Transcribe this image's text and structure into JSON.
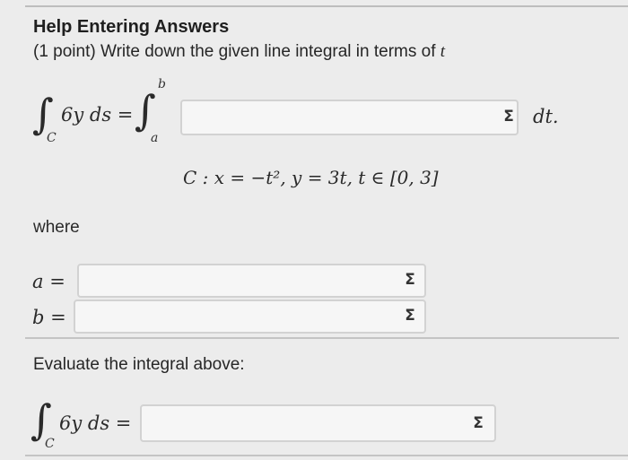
{
  "header": {
    "title": "Help Entering Answers",
    "prompt_points": "(1 point) Write down the given line integral in terms of",
    "prompt_var": "t"
  },
  "integral_1": {
    "integrand": "6y ds =",
    "lower_sub": "C",
    "upper_limit": "b",
    "lower_limit": "a",
    "trailing": "dt."
  },
  "curve": {
    "text": "C : x = −t², y = 3t, t ∈ [0, 3]"
  },
  "where_label": "where",
  "limits": {
    "a_label": "a =",
    "b_label": "b ="
  },
  "evaluate_label": "Evaluate the integral above:",
  "integral_2": {
    "integrand": "6y ds =",
    "lower_sub": "C"
  },
  "sigma_symbol": "Σ",
  "inputs": {
    "integrand_value": "",
    "a_value": "",
    "b_value": "",
    "result_value": ""
  }
}
